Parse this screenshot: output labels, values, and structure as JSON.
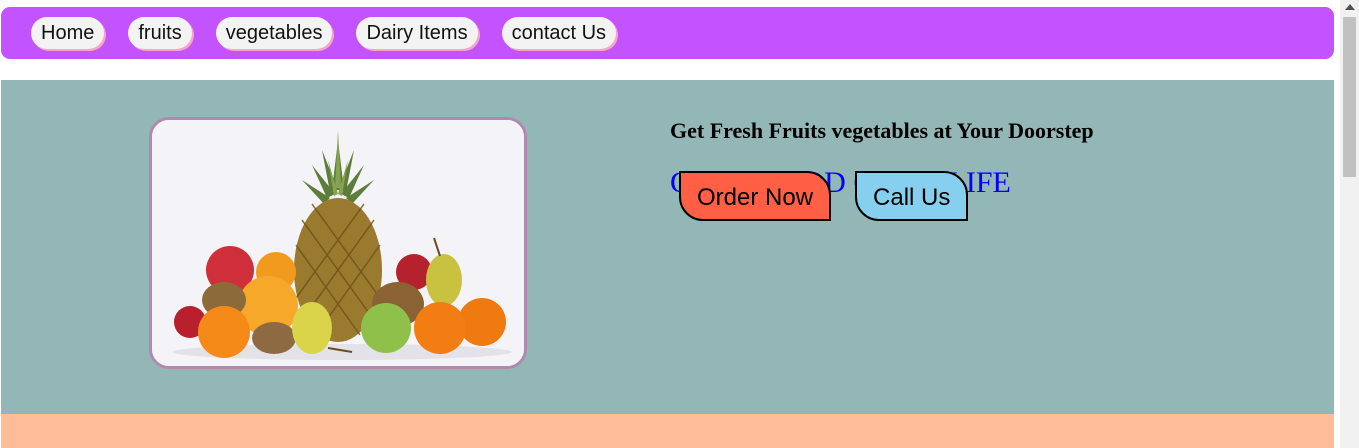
{
  "nav": {
    "items": [
      {
        "label": "Home"
      },
      {
        "label": "fruits"
      },
      {
        "label": "vegetables"
      },
      {
        "label": "Dairy Items"
      },
      {
        "label": "contact Us"
      }
    ]
  },
  "hero": {
    "image_alt": "fruit basket with pineapple, apples, oranges, kiwis and pears",
    "headline": "Get Fresh Fruits vegetables at Your Doorstep",
    "tagline": "GOOD FOOD GOOD LIFE",
    "buttons": {
      "order_label": "Order Now",
      "call_label": "Call Us"
    }
  },
  "colors": {
    "nav_bg": "#c352ff",
    "hero_bg": "#93b6b6",
    "order_button": "#ff5f45",
    "call_button": "#87cfee",
    "tagline": "#0000ff",
    "bottom_band": "#ffbc99"
  },
  "icons": {
    "scroll_up": "chevron-up-icon"
  }
}
